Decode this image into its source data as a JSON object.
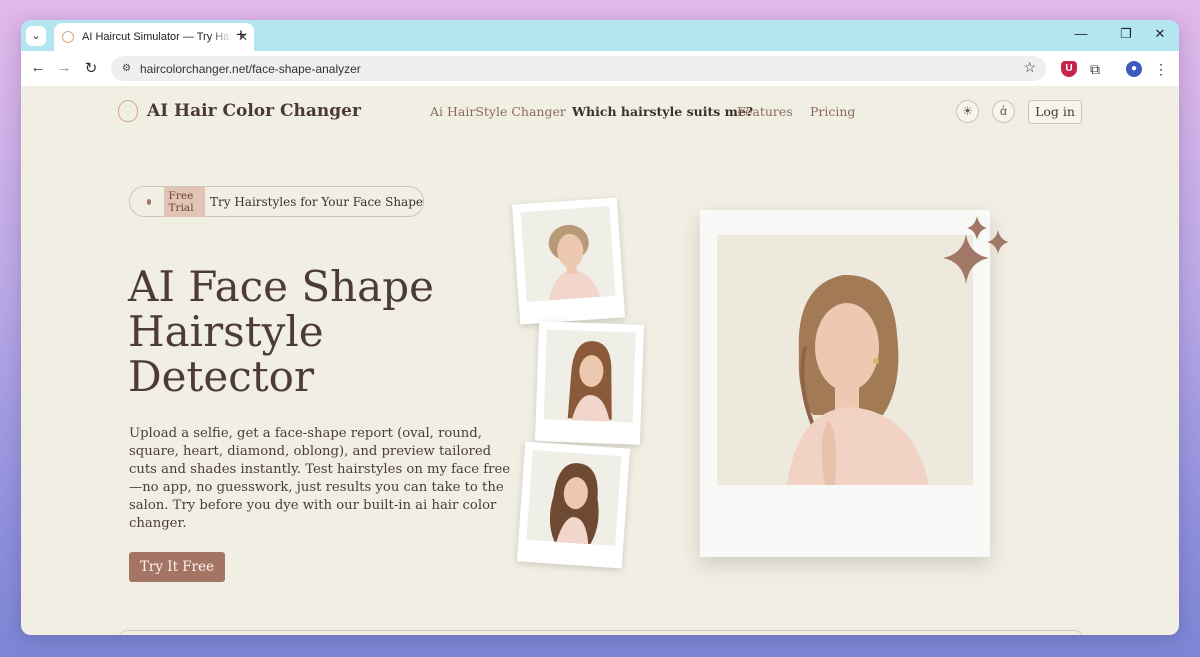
{
  "browser": {
    "tab_title": "AI Haircut Simulator — Try Hairstyles",
    "new_tab": "+",
    "url": "haircolorchanger.net/face-shape-analyzer"
  },
  "site": {
    "logo_text": "AI Hair Color Changer",
    "nav": [
      "Ai HairStyle Changer",
      "Which hairstyle suits me?",
      "Features",
      "Pricing"
    ],
    "login_label": "Log in"
  },
  "hero": {
    "badge": "Free Trial",
    "pill_text": "Try Hairstyles for Your Face Shape",
    "title_lines": [
      "AI Face Shape",
      "Hairstyle",
      "Detector"
    ],
    "description": "Upload a selfie, get a face-shape report (oval, round, square, heart, diamond, oblong), and preview tailored cuts and shades instantly. Test hairstyles on my face free—no app, no guesswork, just results you can take to the salon. Try before you dye with our built-in ai hair color changer.",
    "cta_label": "Try It Free"
  },
  "colors": {
    "page_bg": "#f1efe4",
    "brand": "#a47465",
    "text": "#4d3c35",
    "chat": "#e4541d"
  }
}
